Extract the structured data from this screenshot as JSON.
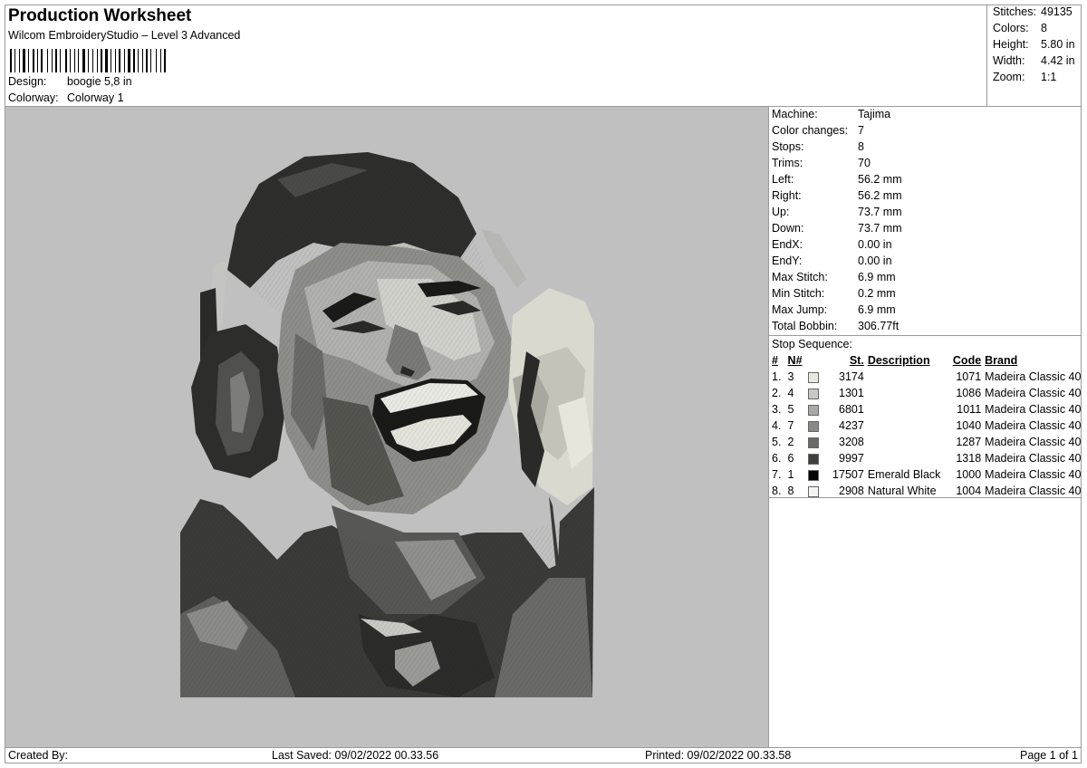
{
  "header": {
    "title": "Production Worksheet",
    "subtitle": "Wilcom EmbroideryStudio – Level 3 Advanced",
    "design_label": "Design:",
    "design_value": "boogie 5,8 in",
    "colorway_label": "Colorway:",
    "colorway_value": "Colorway 1"
  },
  "stats": [
    {
      "label": "Stitches:",
      "value": "49135"
    },
    {
      "label": "Colors:",
      "value": "8"
    },
    {
      "label": "Height:",
      "value": "5.80 in"
    },
    {
      "label": "Width:",
      "value": "4.42 in"
    },
    {
      "label": "Zoom:",
      "value": "1:1"
    }
  ],
  "machine_info": [
    {
      "label": "Machine:",
      "value": "Tajima"
    },
    {
      "label": "Color changes:",
      "value": "7"
    },
    {
      "label": "Stops:",
      "value": "8"
    },
    {
      "label": "Trims:",
      "value": "70"
    },
    {
      "label": "Left:",
      "value": "56.2 mm"
    },
    {
      "label": "Right:",
      "value": "56.2 mm"
    },
    {
      "label": "Up:",
      "value": "73.7 mm"
    },
    {
      "label": "Down:",
      "value": "73.7 mm"
    },
    {
      "label": "EndX:",
      "value": "0.00 in"
    },
    {
      "label": "EndY:",
      "value": "0.00 in"
    },
    {
      "label": "Max Stitch:",
      "value": "6.9 mm"
    },
    {
      "label": "Min Stitch:",
      "value": "0.2 mm"
    },
    {
      "label": "Max Jump:",
      "value": "6.9 mm"
    },
    {
      "label": "Total Bobbin:",
      "value": "306.77ft"
    }
  ],
  "stop_sequence": {
    "title": "Stop Sequence:",
    "headers": {
      "idx": "#",
      "n": "N#",
      "st": "St.",
      "desc": "Description",
      "code": "Code",
      "brand": "Brand"
    },
    "rows": [
      {
        "idx": "1.",
        "n": "3",
        "color": "#e8e8de",
        "st": "3174",
        "desc": "",
        "code": "1071",
        "brand": "Madeira Classic 40"
      },
      {
        "idx": "2.",
        "n": "4",
        "color": "#c8c8c4",
        "st": "1301",
        "desc": "",
        "code": "1086",
        "brand": "Madeira Classic 40"
      },
      {
        "idx": "3.",
        "n": "5",
        "color": "#a9a9a6",
        "st": "6801",
        "desc": "",
        "code": "1011",
        "brand": "Madeira Classic 40"
      },
      {
        "idx": "4.",
        "n": "7",
        "color": "#8a8a88",
        "st": "4237",
        "desc": "",
        "code": "1040",
        "brand": "Madeira Classic 40"
      },
      {
        "idx": "5.",
        "n": "2",
        "color": "#6a6a68",
        "st": "3208",
        "desc": "",
        "code": "1287",
        "brand": "Madeira Classic 40"
      },
      {
        "idx": "6.",
        "n": "6",
        "color": "#3f403d",
        "st": "9997",
        "desc": "",
        "code": "1318",
        "brand": "Madeira Classic 40"
      },
      {
        "idx": "7.",
        "n": "1",
        "color": "#050505",
        "st": "17507",
        "desc": "Emerald Black",
        "code": "1000",
        "brand": "Madeira Classic 40"
      },
      {
        "idx": "8.",
        "n": "8",
        "color": "#f4f4f0",
        "st": "2908",
        "desc": "Natural White",
        "code": "1004",
        "brand": "Madeira Classic 40"
      }
    ]
  },
  "footer": {
    "created_by": "Created By:",
    "last_saved": "Last Saved: 09/02/2022 00.33.56",
    "printed": "Printed: 09/02/2022 00.33.58",
    "page": "Page 1 of 1"
  },
  "colors": {
    "canvas_bg": "#c0c0c0",
    "border": "#9a9a9a"
  }
}
